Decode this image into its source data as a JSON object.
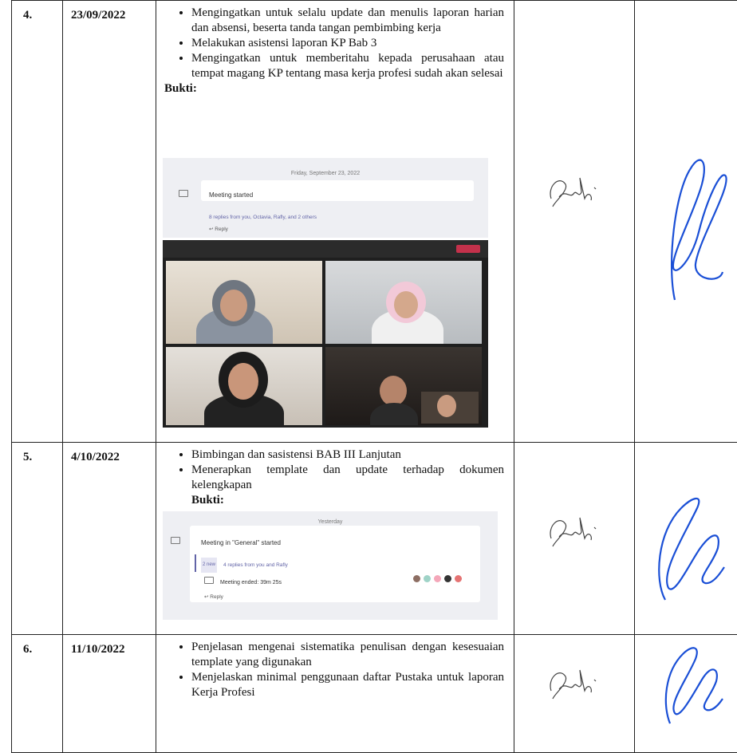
{
  "rows": [
    {
      "no": "4.",
      "date": "23/09/2022",
      "items": [
        "Mengingatkan untuk selalu update dan menulis laporan harian dan absensi, beserta tanda tangan pembimbing kerja",
        "Melakukan asistensi laporan KP Bab 3",
        "Mengingatkan untuk memberitahu kepada perusahaan atau tempat magang KP tentang masa kerja profesi sudah akan selesai"
      ],
      "bukti": "Bukti:",
      "screenshot": {
        "date": "Friday, September 23, 2022",
        "meeting": "Meeting started",
        "replies": "8 replies from you, Octavia, Rafly, and 2 others",
        "reply": "Reply"
      }
    },
    {
      "no": "5.",
      "date": "4/10/2022",
      "items": [
        "Bimbingan dan sasistensi BAB III Lanjutan",
        "Menerapkan template dan update terhadap dokumen kelengkapan"
      ],
      "bukti": "Bukti:",
      "screenshot": {
        "date": "Yesterday",
        "meeting": "Meeting in \"General\" started",
        "pill": "2 new",
        "replies": "4 replies from you and Rafly",
        "ended": "Meeting ended: 39m 25s",
        "reply": "Reply"
      }
    },
    {
      "no": "6.",
      "date": "11/10/2022",
      "items": [
        "Penjelasan mengenai sistematika penulisan dengan kesesuaian template yang digunakan",
        "Menjelaskan minimal penggunaan daftar Pustaka untuk laporan Kerja Profesi"
      ]
    }
  ],
  "colors": {
    "ink_blue": "#1a4fd6",
    "teams_purple": "#6264a7",
    "leave_red": "#c4314b"
  }
}
